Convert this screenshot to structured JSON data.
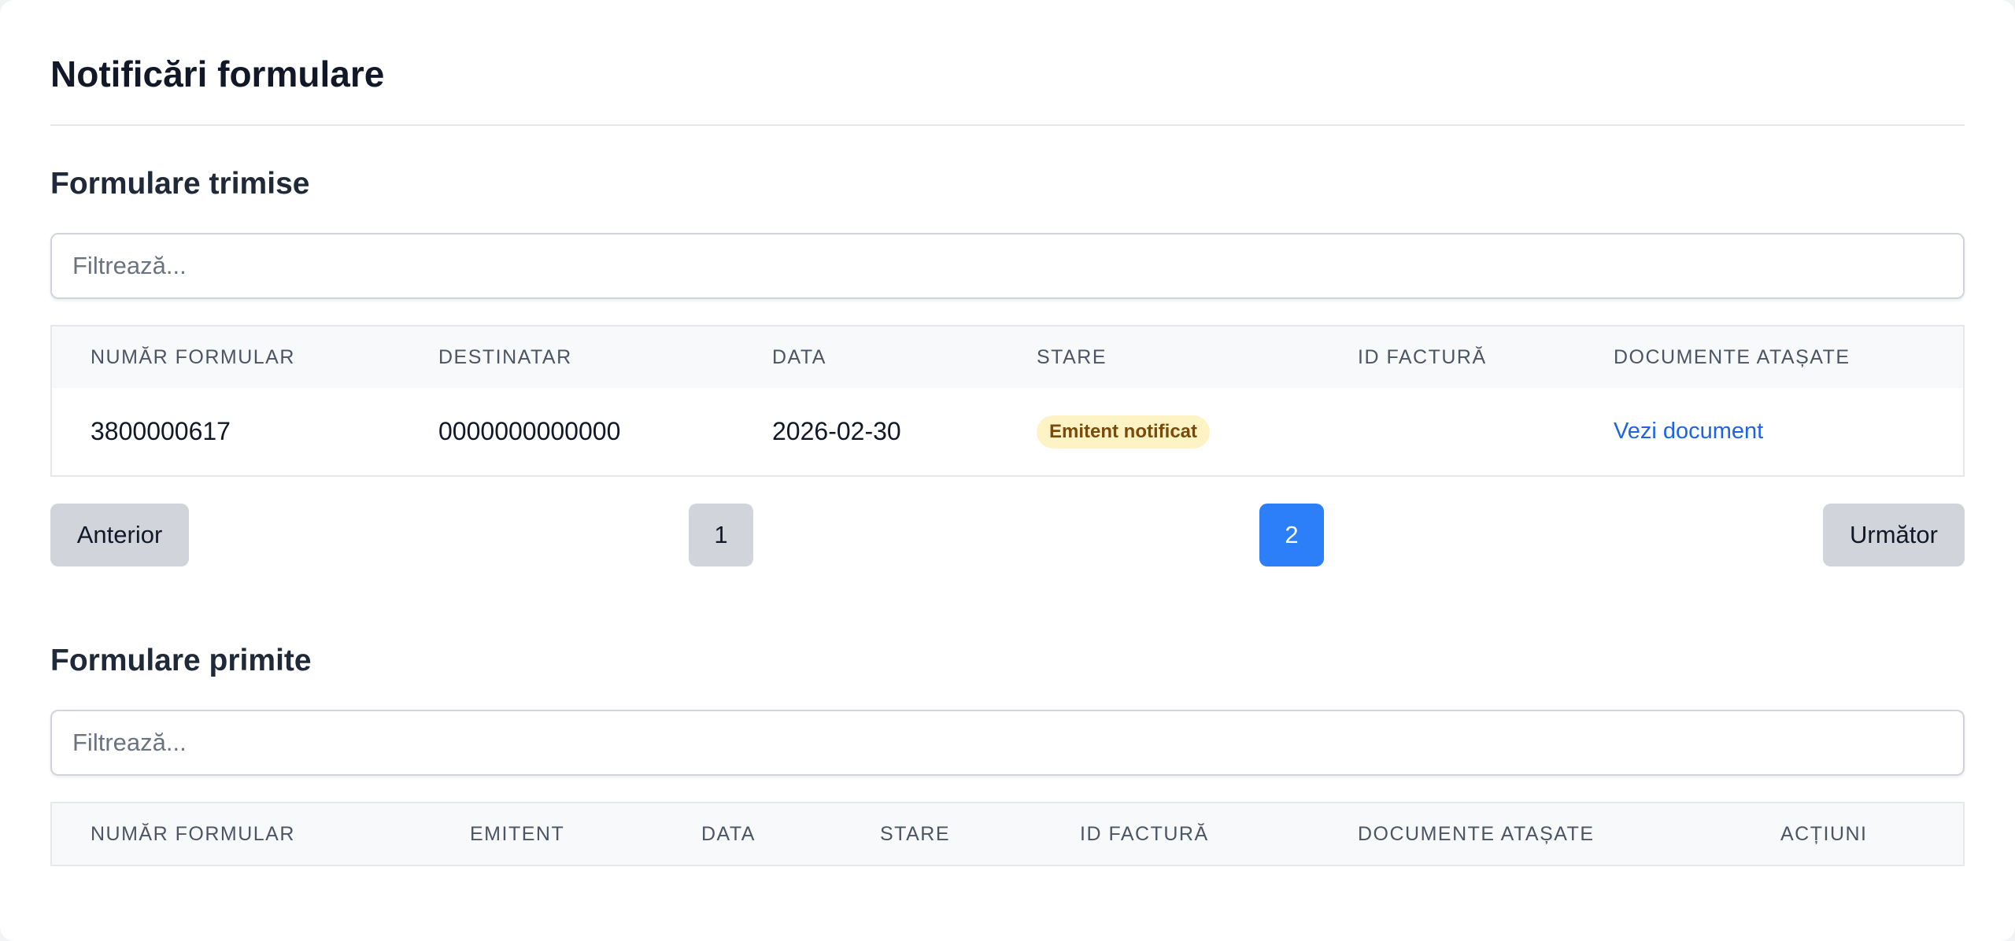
{
  "page": {
    "title": "Notificări formulare"
  },
  "sent": {
    "title": "Formulare trimise",
    "filter_placeholder": "Filtrează...",
    "columns": [
      "NUMĂR FORMULAR",
      "DESTINATAR",
      "DATA",
      "STARE",
      "ID FACTURĂ",
      "DOCUMENTE ATAȘATE"
    ],
    "rows": [
      {
        "numar": "3800000617",
        "destinatar": "0000000000000",
        "data": "2026-02-30",
        "stare": "Emitent notificat",
        "id_factura": "",
        "document_link": "Vezi document"
      }
    ],
    "pagination": {
      "prev_label": "Anterior",
      "next_label": "Următor",
      "pages": [
        "1",
        "2"
      ],
      "current_page": "2"
    }
  },
  "received": {
    "title": "Formulare primite",
    "filter_placeholder": "Filtrează...",
    "columns": [
      "NUMĂR FORMULAR",
      "EMITENT",
      "DATA",
      "STARE",
      "ID FACTURĂ",
      "DOCUMENTE ATAȘATE",
      "ACȚIUNI"
    ]
  },
  "colors": {
    "accent": "#2d7ff9",
    "link": "#1d63e8",
    "badge_bg": "#fdf3c4",
    "badge_text": "#7a4a0a"
  }
}
